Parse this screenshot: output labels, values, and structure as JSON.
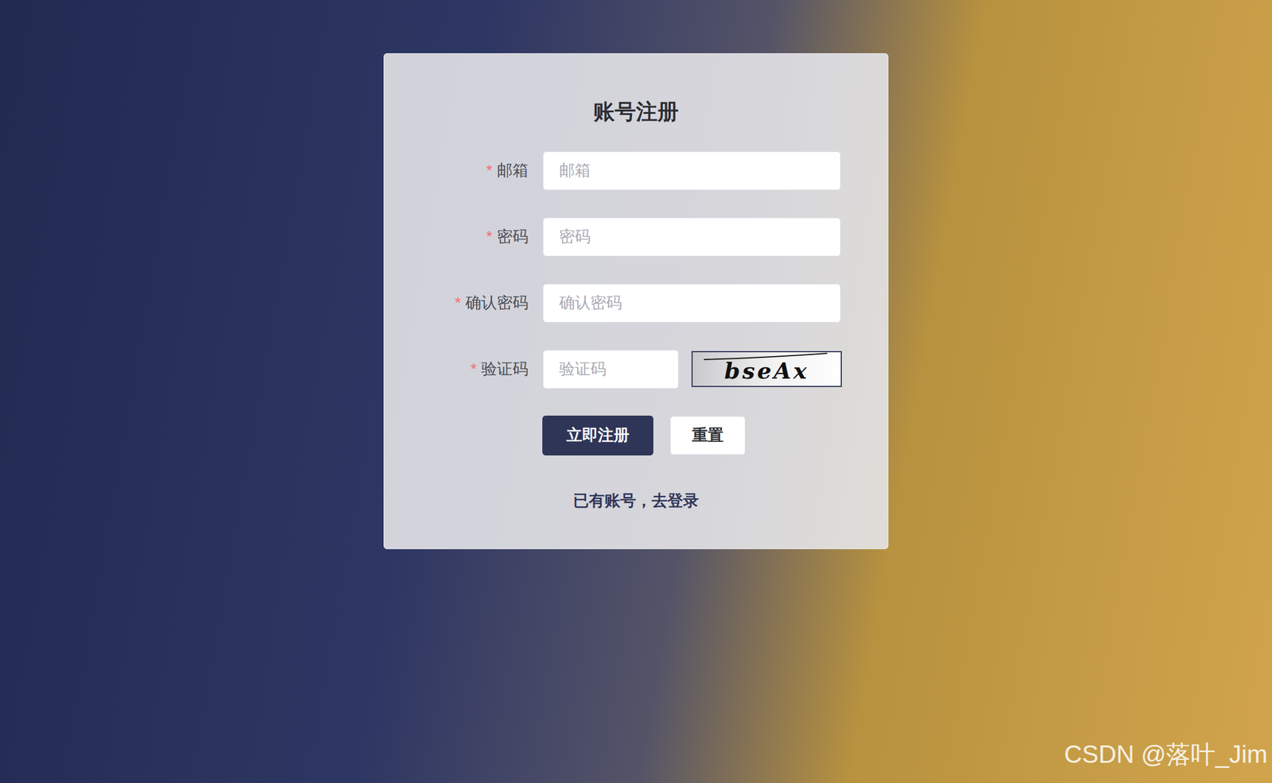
{
  "form": {
    "title": "账号注册",
    "fields": [
      {
        "kind": "text",
        "required": "*",
        "label": "邮箱",
        "placeholder": "邮箱"
      },
      {
        "kind": "text",
        "required": "*",
        "label": "密码",
        "placeholder": "密码"
      },
      {
        "kind": "text",
        "required": "*",
        "label": "确认密码",
        "placeholder": "确认密码"
      },
      {
        "kind": "captcha",
        "required": "*",
        "label": "验证码",
        "placeholder": "验证码",
        "captcha": "bseAx"
      }
    ],
    "buttons": [
      {
        "label": "立即注册",
        "kind": "primary"
      },
      {
        "label": "重置",
        "kind": "plain"
      }
    ],
    "link": "已有账号，去登录"
  },
  "watermark": "CSDN @落叶_Jim"
}
